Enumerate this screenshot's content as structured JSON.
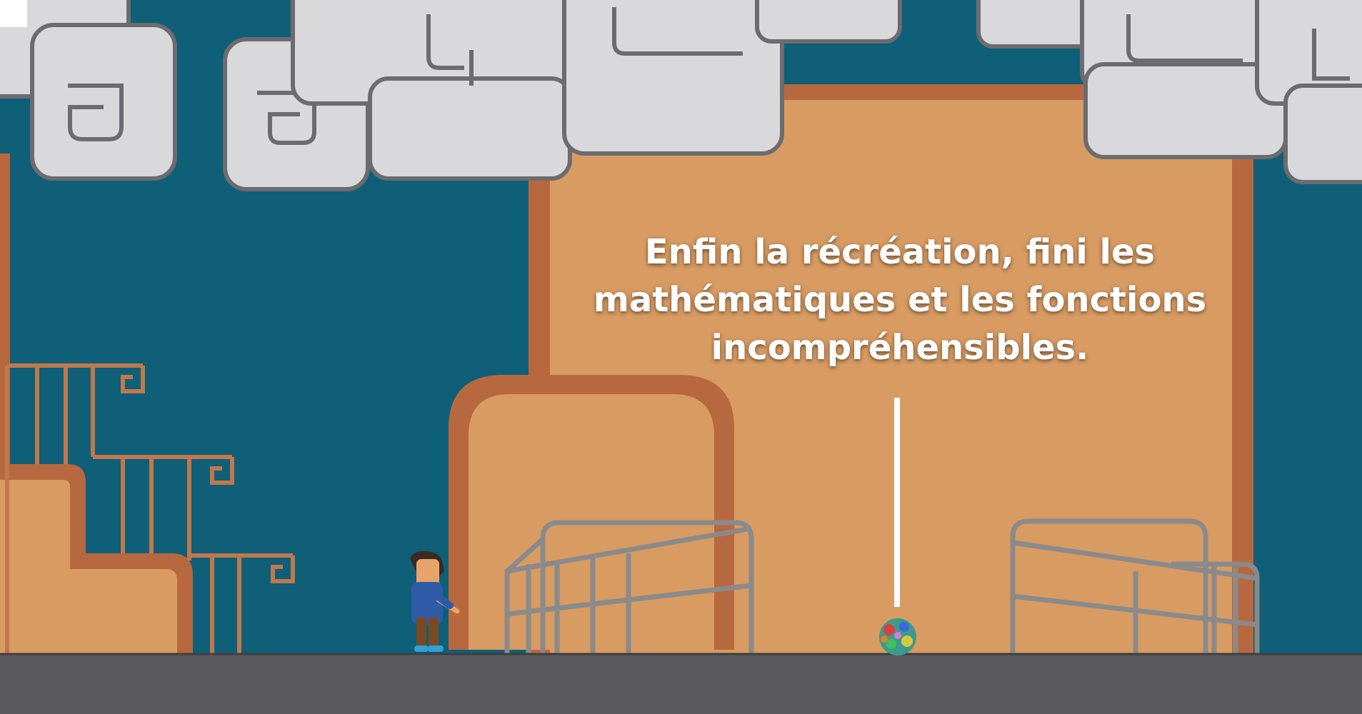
{
  "scene": {
    "caption_lines": [
      "Enfin la récréation, fini les",
      "mathématiques et les fonctions",
      "incompréhensibles."
    ]
  },
  "colors": {
    "wall": "#0f5f78",
    "building_fill": "#d89b62",
    "building_border": "#b8683f",
    "cloud_fill": "#d9d9dc",
    "cloud_outline": "#6b6b70",
    "railing": "#c0784c",
    "bench": "#8a8a8a",
    "ground": "#5a5a5c",
    "caption_text": "#ffffff",
    "pointer_line": "#ffffff"
  }
}
